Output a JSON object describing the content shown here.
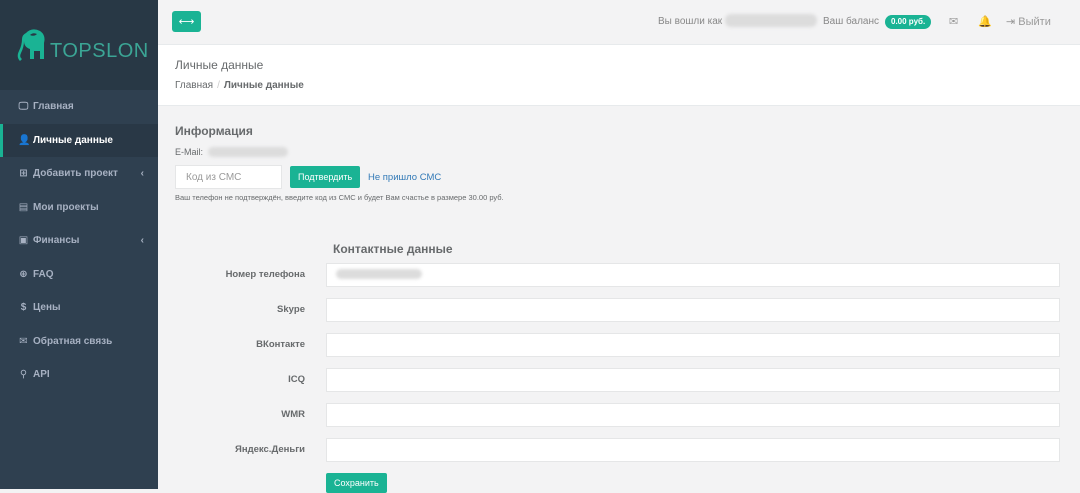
{
  "brand": {
    "name": "TOPSLON",
    "color": "#1ab394"
  },
  "sidebar": {
    "items": [
      {
        "label": "Главная",
        "icon": "desktop-icon",
        "active": false,
        "caret": false
      },
      {
        "label": "Личные данные",
        "icon": "user-icon",
        "active": true,
        "caret": false
      },
      {
        "label": "Добавить проект",
        "icon": "plus-square-icon",
        "active": false,
        "caret": true
      },
      {
        "label": "Мои проекты",
        "icon": "list-icon",
        "active": false,
        "caret": false
      },
      {
        "label": "Финансы",
        "icon": "money-icon",
        "active": false,
        "caret": true
      },
      {
        "label": "FAQ",
        "icon": "lifebuoy-icon",
        "active": false,
        "caret": false
      },
      {
        "label": "Цены",
        "icon": "dollar-icon",
        "active": false,
        "caret": false
      },
      {
        "label": "Обратная связь",
        "icon": "envelope-icon",
        "active": false,
        "caret": false
      },
      {
        "label": "API",
        "icon": "plug-icon",
        "active": false,
        "caret": false
      }
    ]
  },
  "topbar": {
    "logged_in_as": "Вы вошли как",
    "balance_label": "Ваш баланс",
    "balance_value": "0.00 руб.",
    "logout": "Выйти"
  },
  "page": {
    "title": "Личные данные",
    "breadcrumb": {
      "home": "Главная",
      "current": "Личные данные"
    }
  },
  "info": {
    "title": "Информация",
    "email_label": "E-Mail:",
    "sms_placeholder": "Код из СМС",
    "confirm_button": "Подтвердить",
    "no_sms_link": "Не пришло СМС",
    "hint": "Ваш телефон не подтверждён, введите код из СМС и будет Вам счастье в размере 30.00 руб."
  },
  "contacts": {
    "title": "Контактные данные",
    "fields": [
      {
        "label": "Номер телефона",
        "value": ""
      },
      {
        "label": "Skype",
        "value": ""
      },
      {
        "label": "ВКонтакте",
        "value": ""
      },
      {
        "label": "ICQ",
        "value": ""
      },
      {
        "label": "WMR",
        "value": ""
      },
      {
        "label": "Яндекс.Деньги",
        "value": ""
      }
    ],
    "save_button": "Сохранить"
  }
}
